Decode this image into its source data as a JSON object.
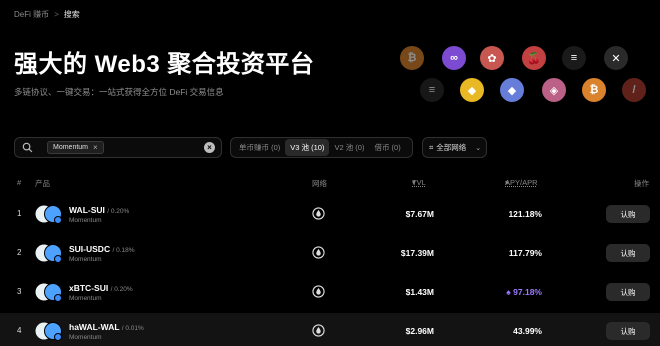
{
  "breadcrumb": {
    "parent": "DeFi 赚币",
    "separator": ">",
    "current": "搜索"
  },
  "hero": {
    "title": "强大的 Web3 聚合投资平台",
    "subtitle": "多链协议、一键交易：一站式获得全方位 DeFi 交易信息"
  },
  "coins": [
    {
      "icon": "bitcoin-icon",
      "glyph": "₿",
      "color": "#e8811a",
      "dim": true
    },
    {
      "icon": "polygon-icon",
      "glyph": "∞",
      "color": "#8247e5",
      "dim": false
    },
    {
      "icon": "ape-icon",
      "glyph": "✿",
      "color": "#d8534c",
      "dim": false
    },
    {
      "icon": "cherry-icon",
      "glyph": "🍒",
      "color": "#d43b3b",
      "dim": false
    },
    {
      "icon": "solana-icon",
      "glyph": "≡",
      "color": "#1a1a1a",
      "dim": false
    },
    {
      "icon": "okx-icon",
      "glyph": "✕",
      "color": "#2a2a2a",
      "dim": false
    },
    {
      "icon": "tron-icon",
      "glyph": "≡",
      "color": "#2b2b2b",
      "dim": true
    },
    {
      "icon": "bnb-icon",
      "glyph": "◆",
      "color": "#f0b90b",
      "dim": false
    },
    {
      "icon": "ethereum-icon",
      "glyph": "◆",
      "color": "#627eea",
      "dim": false
    },
    {
      "icon": "shield-icon",
      "glyph": "◈",
      "color": "#c75c8a",
      "dim": false
    },
    {
      "icon": "bitcoin-icon",
      "glyph": "₿",
      "color": "#e8811a",
      "dim": false
    },
    {
      "icon": "slash-icon",
      "glyph": "/",
      "color": "#c0392b",
      "dim": true
    }
  ],
  "search": {
    "chip": "Momentum",
    "chip_remove": "×",
    "clear": "×"
  },
  "tabs": [
    {
      "label": "单币赚币 (0)",
      "active": false
    },
    {
      "label": "V3 池 (10)",
      "active": true
    },
    {
      "label": "V2 池 (0)",
      "active": false
    },
    {
      "label": "借币 (0)",
      "active": false
    }
  ],
  "network_filter": {
    "label": "全部网络"
  },
  "table": {
    "headers": {
      "index": "#",
      "product": "产品",
      "network": "网络",
      "tvl": "TVL",
      "apy": "APY/APR",
      "action": "操作"
    },
    "rows": [
      {
        "index": "1",
        "pair": "WAL-SUI",
        "fee": "/ 0.20%",
        "protocol": "Momentum",
        "tvl": "$7.67M",
        "apy": "121.18%",
        "boost": false,
        "button": "认购",
        "highlight": false
      },
      {
        "index": "2",
        "pair": "SUI-USDC",
        "fee": "/ 0.18%",
        "protocol": "Momentum",
        "tvl": "$17.39M",
        "apy": "117.79%",
        "boost": false,
        "button": "认购",
        "highlight": false
      },
      {
        "index": "3",
        "pair": "xBTC-SUI",
        "fee": "/ 0.20%",
        "protocol": "Momentum",
        "tvl": "$1.43M",
        "apy": "97.18%",
        "boost": true,
        "button": "认购",
        "highlight": false
      },
      {
        "index": "4",
        "pair": "haWAL-WAL",
        "fee": "/ 0.01%",
        "protocol": "Momentum",
        "tvl": "$2.96M",
        "apy": "43.99%",
        "boost": false,
        "button": "认购",
        "highlight": true
      }
    ]
  }
}
